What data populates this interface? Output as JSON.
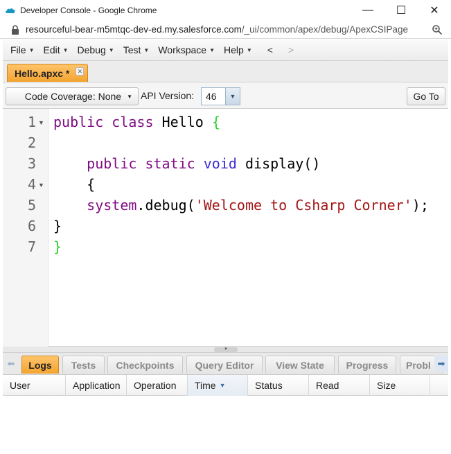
{
  "window": {
    "title": "Developer Console - Google Chrome",
    "minimize": "—",
    "maximize": "☐",
    "close": "✕"
  },
  "address": {
    "host": "resourceful-bear-m5mtqc-dev-ed.my.salesforce.com",
    "path": "/_ui/common/apex/debug/ApexCSIPage"
  },
  "menu": {
    "file": "File",
    "edit": "Edit",
    "debug": "Debug",
    "test": "Test",
    "workspace": "Workspace",
    "help": "Help",
    "back": "<",
    "forward": ">"
  },
  "file_tab": {
    "label": "Hello.apxc *",
    "close": "✕"
  },
  "toolbar": {
    "coverage": "Code Coverage: None",
    "api_label": "API Version:",
    "api_value": "46",
    "goto": "Go To"
  },
  "editor": {
    "line_numbers": [
      "1",
      "2",
      "3",
      "4",
      "5",
      "6",
      "7"
    ],
    "line1": {
      "kw1": "public",
      "kw2": "class",
      "name": "Hello",
      "brace": "{"
    },
    "line3": {
      "kw1": "public",
      "kw2": "static",
      "kw3": "void",
      "method": "display()"
    },
    "line4": "{",
    "line5": {
      "obj": "system",
      "call": ".debug(",
      "str": "'Welcome to Csharp Corner'",
      "end": ");"
    },
    "line6": "}",
    "line7": "}"
  },
  "bottom_tabs": [
    "Logs",
    "Tests",
    "Checkpoints",
    "Query Editor",
    "View State",
    "Progress",
    "Probl"
  ],
  "grid": {
    "columns": [
      "User",
      "Application",
      "Operation",
      "Time",
      "Status",
      "Read",
      "Size"
    ]
  },
  "colors": {
    "active_tab": "#f3a430",
    "keyword": "#7f0d84",
    "type_keyword": "#3a2bd1",
    "string": "#a31515",
    "green_brace": "#2bd12b"
  }
}
